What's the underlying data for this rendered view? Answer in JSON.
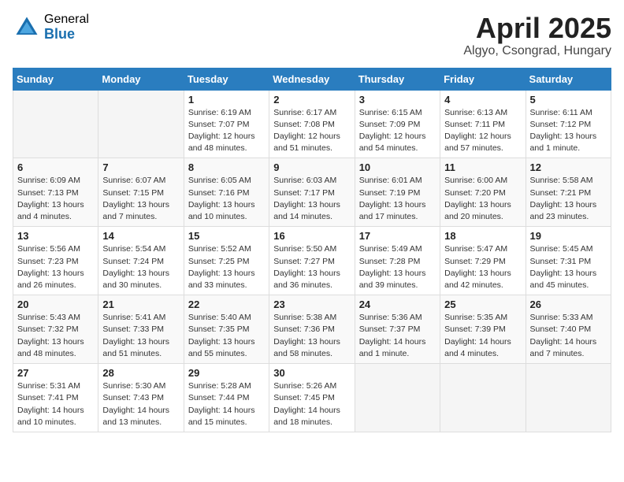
{
  "header": {
    "logo_general": "General",
    "logo_blue": "Blue",
    "month_title": "April 2025",
    "location": "Algyo, Csongrad, Hungary"
  },
  "days_of_week": [
    "Sunday",
    "Monday",
    "Tuesday",
    "Wednesday",
    "Thursday",
    "Friday",
    "Saturday"
  ],
  "weeks": [
    [
      {
        "day": "",
        "detail": ""
      },
      {
        "day": "",
        "detail": ""
      },
      {
        "day": "1",
        "detail": "Sunrise: 6:19 AM\nSunset: 7:07 PM\nDaylight: 12 hours\nand 48 minutes."
      },
      {
        "day": "2",
        "detail": "Sunrise: 6:17 AM\nSunset: 7:08 PM\nDaylight: 12 hours\nand 51 minutes."
      },
      {
        "day": "3",
        "detail": "Sunrise: 6:15 AM\nSunset: 7:09 PM\nDaylight: 12 hours\nand 54 minutes."
      },
      {
        "day": "4",
        "detail": "Sunrise: 6:13 AM\nSunset: 7:11 PM\nDaylight: 12 hours\nand 57 minutes."
      },
      {
        "day": "5",
        "detail": "Sunrise: 6:11 AM\nSunset: 7:12 PM\nDaylight: 13 hours\nand 1 minute."
      }
    ],
    [
      {
        "day": "6",
        "detail": "Sunrise: 6:09 AM\nSunset: 7:13 PM\nDaylight: 13 hours\nand 4 minutes."
      },
      {
        "day": "7",
        "detail": "Sunrise: 6:07 AM\nSunset: 7:15 PM\nDaylight: 13 hours\nand 7 minutes."
      },
      {
        "day": "8",
        "detail": "Sunrise: 6:05 AM\nSunset: 7:16 PM\nDaylight: 13 hours\nand 10 minutes."
      },
      {
        "day": "9",
        "detail": "Sunrise: 6:03 AM\nSunset: 7:17 PM\nDaylight: 13 hours\nand 14 minutes."
      },
      {
        "day": "10",
        "detail": "Sunrise: 6:01 AM\nSunset: 7:19 PM\nDaylight: 13 hours\nand 17 minutes."
      },
      {
        "day": "11",
        "detail": "Sunrise: 6:00 AM\nSunset: 7:20 PM\nDaylight: 13 hours\nand 20 minutes."
      },
      {
        "day": "12",
        "detail": "Sunrise: 5:58 AM\nSunset: 7:21 PM\nDaylight: 13 hours\nand 23 minutes."
      }
    ],
    [
      {
        "day": "13",
        "detail": "Sunrise: 5:56 AM\nSunset: 7:23 PM\nDaylight: 13 hours\nand 26 minutes."
      },
      {
        "day": "14",
        "detail": "Sunrise: 5:54 AM\nSunset: 7:24 PM\nDaylight: 13 hours\nand 30 minutes."
      },
      {
        "day": "15",
        "detail": "Sunrise: 5:52 AM\nSunset: 7:25 PM\nDaylight: 13 hours\nand 33 minutes."
      },
      {
        "day": "16",
        "detail": "Sunrise: 5:50 AM\nSunset: 7:27 PM\nDaylight: 13 hours\nand 36 minutes."
      },
      {
        "day": "17",
        "detail": "Sunrise: 5:49 AM\nSunset: 7:28 PM\nDaylight: 13 hours\nand 39 minutes."
      },
      {
        "day": "18",
        "detail": "Sunrise: 5:47 AM\nSunset: 7:29 PM\nDaylight: 13 hours\nand 42 minutes."
      },
      {
        "day": "19",
        "detail": "Sunrise: 5:45 AM\nSunset: 7:31 PM\nDaylight: 13 hours\nand 45 minutes."
      }
    ],
    [
      {
        "day": "20",
        "detail": "Sunrise: 5:43 AM\nSunset: 7:32 PM\nDaylight: 13 hours\nand 48 minutes."
      },
      {
        "day": "21",
        "detail": "Sunrise: 5:41 AM\nSunset: 7:33 PM\nDaylight: 13 hours\nand 51 minutes."
      },
      {
        "day": "22",
        "detail": "Sunrise: 5:40 AM\nSunset: 7:35 PM\nDaylight: 13 hours\nand 55 minutes."
      },
      {
        "day": "23",
        "detail": "Sunrise: 5:38 AM\nSunset: 7:36 PM\nDaylight: 13 hours\nand 58 minutes."
      },
      {
        "day": "24",
        "detail": "Sunrise: 5:36 AM\nSunset: 7:37 PM\nDaylight: 14 hours\nand 1 minute."
      },
      {
        "day": "25",
        "detail": "Sunrise: 5:35 AM\nSunset: 7:39 PM\nDaylight: 14 hours\nand 4 minutes."
      },
      {
        "day": "26",
        "detail": "Sunrise: 5:33 AM\nSunset: 7:40 PM\nDaylight: 14 hours\nand 7 minutes."
      }
    ],
    [
      {
        "day": "27",
        "detail": "Sunrise: 5:31 AM\nSunset: 7:41 PM\nDaylight: 14 hours\nand 10 minutes."
      },
      {
        "day": "28",
        "detail": "Sunrise: 5:30 AM\nSunset: 7:43 PM\nDaylight: 14 hours\nand 13 minutes."
      },
      {
        "day": "29",
        "detail": "Sunrise: 5:28 AM\nSunset: 7:44 PM\nDaylight: 14 hours\nand 15 minutes."
      },
      {
        "day": "30",
        "detail": "Sunrise: 5:26 AM\nSunset: 7:45 PM\nDaylight: 14 hours\nand 18 minutes."
      },
      {
        "day": "",
        "detail": ""
      },
      {
        "day": "",
        "detail": ""
      },
      {
        "day": "",
        "detail": ""
      }
    ]
  ]
}
